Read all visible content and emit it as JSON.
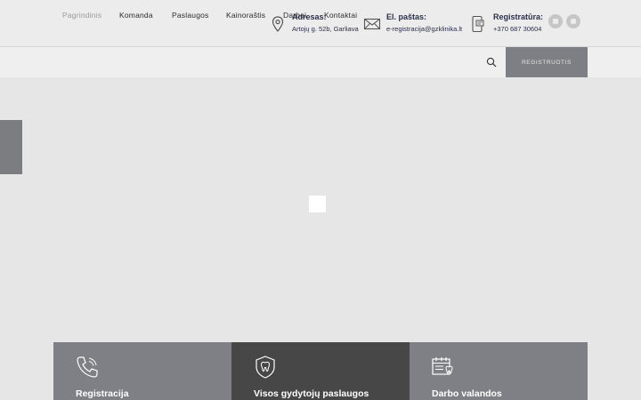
{
  "topbar": {
    "address": {
      "label": "Adresas:",
      "value": "Artojų g. 52b, Garliava",
      "icon": "map-pin-icon"
    },
    "email": {
      "label": "El. paštas:",
      "value": "e-registracija@gzklinika.lt",
      "icon": "envelope-icon"
    },
    "registration": {
      "label": "Registratūra:",
      "value": "+370 687 30604",
      "icon": "phone-card-icon"
    },
    "social": [
      "facebook-icon",
      "instagram-icon"
    ]
  },
  "nav": {
    "items": [
      {
        "label": "Pagrindinis",
        "active": true
      },
      {
        "label": "Komanda"
      },
      {
        "label": "Paslaugos"
      },
      {
        "label": "Kainoraštis"
      },
      {
        "label": "Darbai"
      },
      {
        "label": "Kontaktai"
      }
    ],
    "search_icon": "search-icon",
    "register_label": "REGISTRUOTIS"
  },
  "cards": [
    {
      "title": "Registracija",
      "icon": "phone-icon",
      "color": "#7f8085"
    },
    {
      "title": "Visos gydytojų paslaugos",
      "icon": "tooth-shield-icon",
      "color": "#474747"
    },
    {
      "title": "Darbo valandos",
      "icon": "calendar-tooth-icon",
      "color": "#7f8085"
    }
  ],
  "colors": {
    "accent_dark": "#2b2f4a",
    "button_gray": "#7e7f84"
  }
}
